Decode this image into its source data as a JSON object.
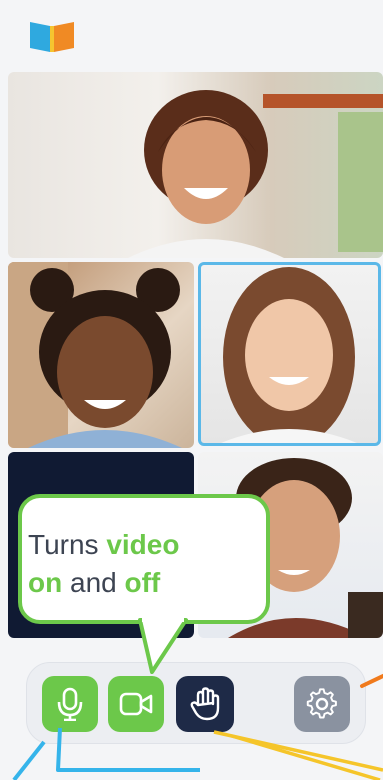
{
  "callout": {
    "prefix": "Turns ",
    "w1": "video",
    "nl": "",
    "w2": "on",
    "mid": " and ",
    "w3": "off"
  },
  "colors": {
    "accent": "#6cc84a",
    "dark": "#1e2a47",
    "highlight": "#5bb8e8",
    "gray": "#8a92a0"
  },
  "icons": {
    "mic": "microphone-icon",
    "cam": "video-camera-icon",
    "hand": "raise-hand-icon",
    "gear": "settings-gear-icon",
    "logo": "book-logo-icon"
  }
}
